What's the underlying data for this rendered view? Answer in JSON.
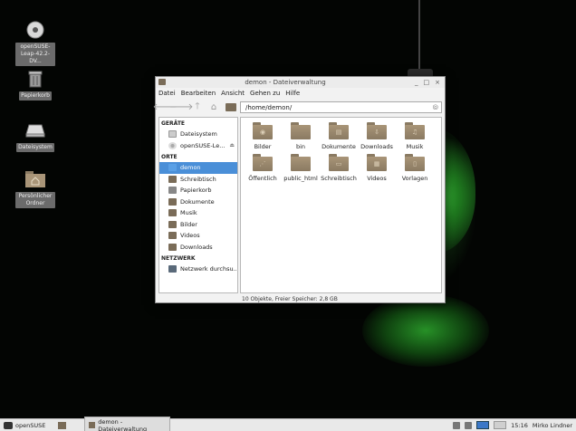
{
  "desktop": {
    "icons": [
      {
        "label": "openSUSE-Leap-42.2-DV...",
        "icon": "disc-icon"
      },
      {
        "label": "Papierkorb",
        "icon": "trash-icon"
      },
      {
        "label": "Dateisystem",
        "icon": "drive-icon"
      },
      {
        "label": "Persönlicher Ordner",
        "icon": "home-folder-icon"
      }
    ]
  },
  "window": {
    "title": "demon - Dateiverwaltung",
    "controls": {
      "minimize": "_",
      "maximize": "□",
      "close": "×"
    },
    "menu": [
      "Datei",
      "Bearbeiten",
      "Ansicht",
      "Gehen zu",
      "Hilfe"
    ],
    "path": "/home/demon/",
    "sidebar": {
      "sections": [
        {
          "heading": "GERÄTE",
          "items": [
            {
              "label": "Dateisystem",
              "icon": "drive-icon"
            },
            {
              "label": "openSUSE-Le...",
              "icon": "disc-icon",
              "eject": "⏏"
            }
          ]
        },
        {
          "heading": "ORTE",
          "items": [
            {
              "label": "demon",
              "icon": "home-icon",
              "active": true
            },
            {
              "label": "Schreibtisch",
              "icon": "folder-icon"
            },
            {
              "label": "Papierkorb",
              "icon": "trash-icon"
            },
            {
              "label": "Dokumente",
              "icon": "folder-icon"
            },
            {
              "label": "Musik",
              "icon": "folder-icon"
            },
            {
              "label": "Bilder",
              "icon": "folder-icon"
            },
            {
              "label": "Videos",
              "icon": "folder-icon"
            },
            {
              "label": "Downloads",
              "icon": "folder-icon"
            }
          ]
        },
        {
          "heading": "NETZWERK",
          "items": [
            {
              "label": "Netzwerk durchsu...",
              "icon": "network-icon"
            }
          ]
        }
      ]
    },
    "files": [
      {
        "name": "Bilder",
        "glyph": "◉"
      },
      {
        "name": "bin",
        "glyph": ""
      },
      {
        "name": "Dokumente",
        "glyph": "▤"
      },
      {
        "name": "Downloads",
        "glyph": "⇩"
      },
      {
        "name": "Musik",
        "glyph": "♫"
      },
      {
        "name": "Öffentlich",
        "glyph": "⋰"
      },
      {
        "name": "public_html",
        "glyph": ""
      },
      {
        "name": "Schreibtisch",
        "glyph": "▭"
      },
      {
        "name": "Videos",
        "glyph": "▦"
      },
      {
        "name": "Vorlagen",
        "glyph": "▯"
      }
    ],
    "status": "10 Objekte, Freier Speicher: 2,8 GB"
  },
  "taskbar": {
    "start_label": "openSUSE",
    "task_label": "demon - Dateiverwaltung",
    "clock": "15:16",
    "user": "Mirko Lindner"
  }
}
